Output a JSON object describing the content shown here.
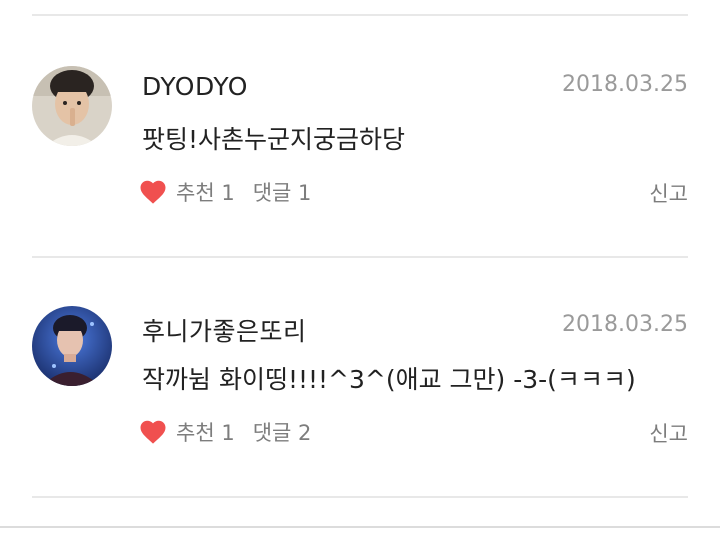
{
  "comments": [
    {
      "author": "DYODYO",
      "date": "2018.03.25",
      "text": "팟팅!사촌누군지궁금하당",
      "like_label": "추천 1",
      "reply_label": "댓글 1",
      "report_label": "신고"
    },
    {
      "author": "후니가좋은또리",
      "date": "2018.03.25",
      "text": "작까뉨 화이띵!!!!^3^(애교 그만) -3-(ㅋㅋㅋ)",
      "like_label": "추천 1",
      "reply_label": "댓글 2",
      "report_label": "신고"
    }
  ],
  "icons": {
    "like": "heart-icon"
  },
  "colors": {
    "heart": "#f0504f",
    "date": "#9a9a9a",
    "meta": "#7d7d7d",
    "divider": "#e8e8e8"
  }
}
